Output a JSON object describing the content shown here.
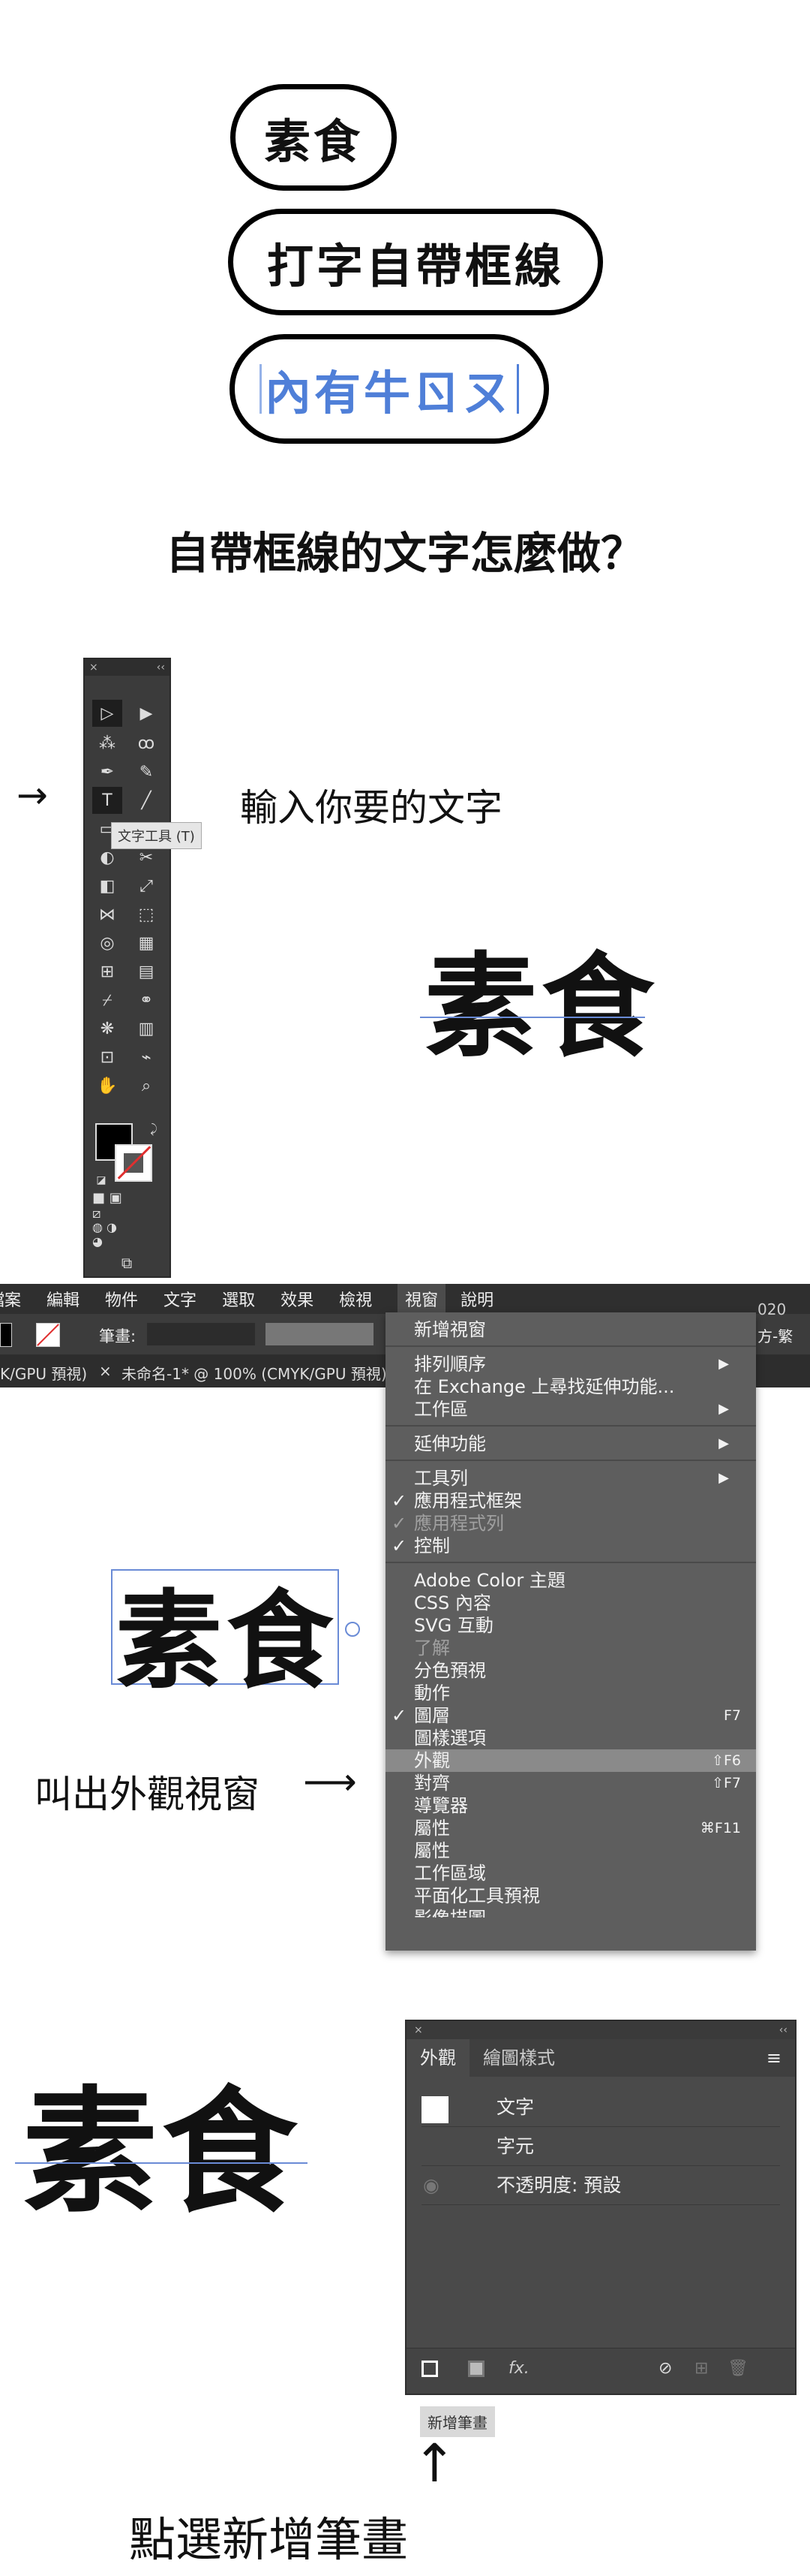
{
  "pills": [
    "素食",
    "打字自帶框線",
    "內有牛ㄖㄡ"
  ],
  "headline": "自帶框線的文字怎麼做？",
  "toolbar": {
    "close": "×",
    "collapse": "‹‹",
    "tooltip": "文字工具 (T)"
  },
  "step1": {
    "arrow": "→",
    "label": "輸入你要的文字"
  },
  "sample_text": "素食",
  "menubar": {
    "items": [
      "檔案",
      "編輯",
      "物件",
      "文字",
      "選取",
      "效果",
      "檢視"
    ],
    "active": "視窗",
    "help": "說明"
  },
  "ctrl": {
    "stroke_label": "筆畫:",
    "right_text": "方-繁",
    "version": "020"
  },
  "tabs": [
    "K/GPU 預視)",
    "未命名-1* @ 100% (CMYK/GPU 預視)"
  ],
  "menu": {
    "items": [
      {
        "label": "新增視窗"
      },
      {
        "label": "排列順序",
        "sub": "▶"
      },
      {
        "label": "在 Exchange 上尋找延伸功能..."
      },
      {
        "label": "工作區",
        "sub": "▶"
      },
      {
        "label": "延伸功能",
        "sub": "▶"
      },
      {
        "label": "工具列",
        "sub": "▶"
      },
      {
        "label": "應用程式框架",
        "check": "✓"
      },
      {
        "label": "應用程式列",
        "check": "✓",
        "disabled": true
      },
      {
        "label": "控制",
        "check": "✓"
      },
      {
        "label": "Adobe Color 主題"
      },
      {
        "label": "CSS 內容"
      },
      {
        "label": "SVG 互動"
      },
      {
        "label": "了解",
        "disabled": true
      },
      {
        "label": "分色預視"
      },
      {
        "label": "動作"
      },
      {
        "label": "圖層",
        "check": "✓",
        "shortcut": "F7"
      },
      {
        "label": "圖樣選項"
      },
      {
        "label": "外觀",
        "shortcut": "⇧F6",
        "highlight": true
      },
      {
        "label": "對齊",
        "shortcut": "⇧F7"
      },
      {
        "label": "導覽器"
      },
      {
        "label": "屬性",
        "shortcut": "⌘F11"
      },
      {
        "label": "屬性"
      },
      {
        "label": "工作區域"
      },
      {
        "label": "平面化工具預視"
      },
      {
        "label": "影像描圖"
      }
    ]
  },
  "step2": {
    "label": "叫出外觀視窗",
    "arrow": "⟶"
  },
  "panel": {
    "close": "×",
    "collapse": "‹‹",
    "tab_active": "外觀",
    "tab_other": "繪圖樣式",
    "menu_icon": "≡",
    "row_type": "文字",
    "row_char": "字元",
    "row_opacity": "不透明度: 預設",
    "tooltip": "新增筆畫"
  },
  "step3": {
    "arrow": "↑",
    "label": "點選新增筆畫"
  },
  "colors": {
    "accent": "#4f7fd8",
    "panel": "#4a4a4a",
    "menu": "#5e5e5e"
  }
}
